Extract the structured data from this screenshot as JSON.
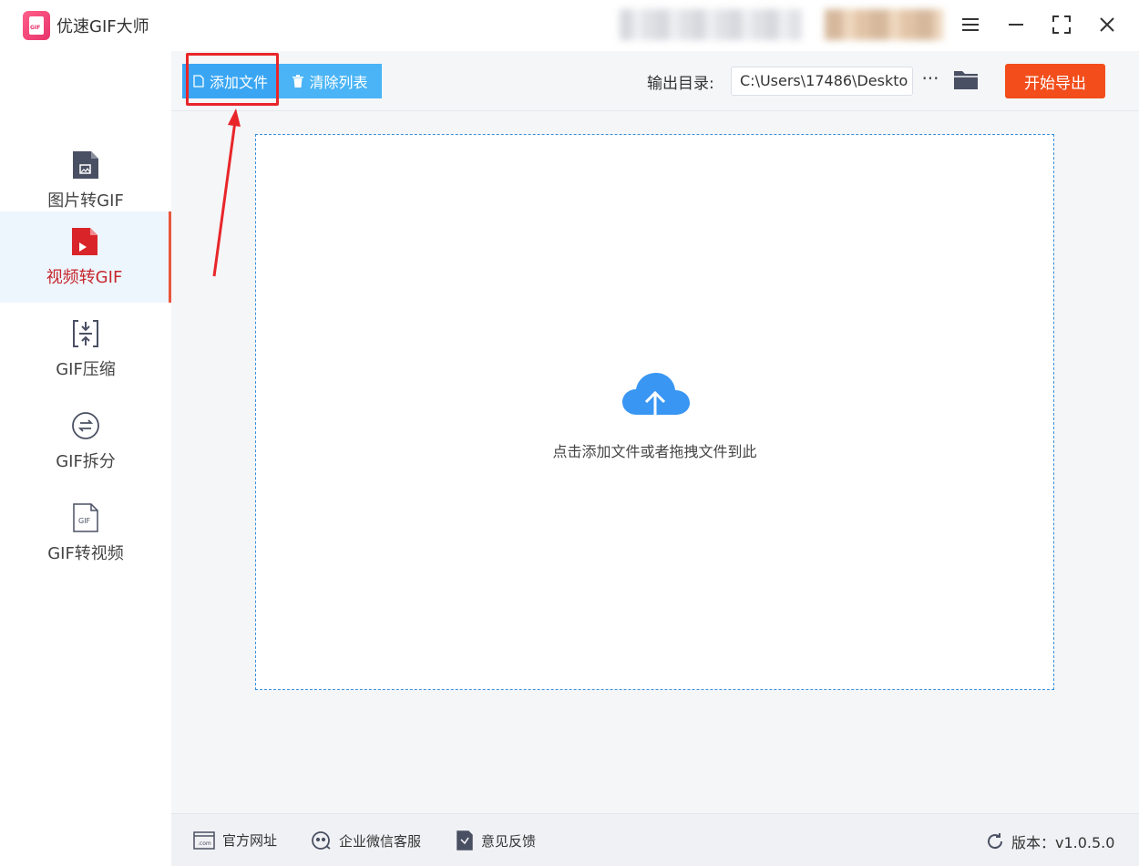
{
  "window": {
    "title": "优速GIF大师",
    "logo_text": "GIF"
  },
  "sidebar": {
    "items": [
      {
        "label": "图片转GIF",
        "icon": "image-file-icon",
        "active": false
      },
      {
        "label": "视频转GIF",
        "icon": "video-file-icon",
        "active": true
      },
      {
        "label": "GIF压缩",
        "icon": "compress-icon",
        "active": false
      },
      {
        "label": "GIF拆分",
        "icon": "split-icon",
        "active": false
      },
      {
        "label": "GIF转视频",
        "icon": "gif-file-icon",
        "active": false
      }
    ]
  },
  "toolbar": {
    "add_label": "添加文件",
    "clear_label": "清除列表",
    "output_label": "输出目录:",
    "output_path": "C:\\Users\\17486\\Deskto",
    "more_label": "···",
    "export_label": "开始导出"
  },
  "dropzone": {
    "hint": "点击添加文件或者拖拽文件到此"
  },
  "footer": {
    "website": "官方网址",
    "wechat": "企业微信客服",
    "feedback": "意见反馈",
    "version": "版本：v1.0.5.0"
  },
  "colors": {
    "primary": "#3aa6f3",
    "export": "#f24d1b",
    "active_text": "#c5272d",
    "annotation": "#e8262a"
  }
}
